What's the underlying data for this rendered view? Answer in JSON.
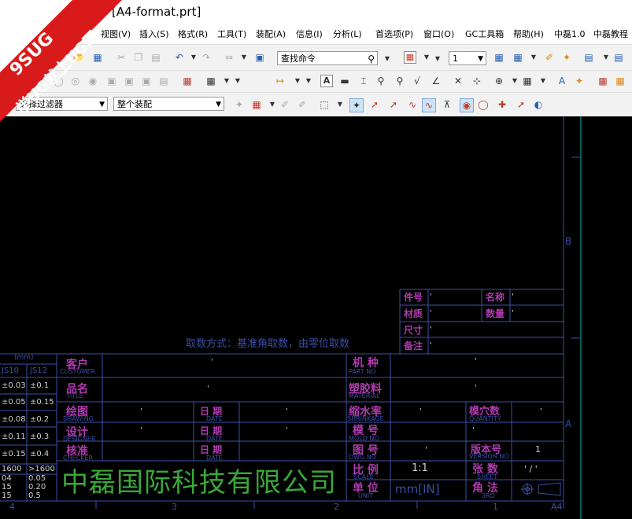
{
  "window": {
    "title": "[A4-format.prt]"
  },
  "watermark": {
    "line1": "9SUG",
    "line2": "学UG就上UG网"
  },
  "menu": [
    "视图(V)",
    "插入(S)",
    "格式(R)",
    "工具(T)",
    "装配(A)",
    "信息(I)",
    "分析(L)",
    "首选项(P)",
    "窗口(O)",
    "GC工具箱",
    "帮助(H)",
    "中磊1.0",
    "中磊教程"
  ],
  "toolbar": {
    "command_search": "查找命令",
    "layer_value": "1",
    "filter_placeholder": "选择过滤器",
    "assembly_scope": "整个装配"
  },
  "drawing": {
    "zone_labels": {
      "b": "B",
      "a": "A",
      "a4": "A4"
    },
    "bottom_ruler": [
      "4",
      "3",
      "2",
      "1"
    ],
    "note": "取数方式：基准角取数，由零位取数",
    "part_table": {
      "part_no": "件号",
      "name": "名称",
      "material": "材质",
      "qty": "数量",
      "size": "尺寸",
      "remark": "备注",
      "tick": "'"
    },
    "tolerance": {
      "header": "(mm)",
      "cols": [
        "JS10",
        "JS12"
      ],
      "rows": [
        [
          "±0.03",
          "±0.1"
        ],
        [
          "±0.05",
          "±0.15"
        ],
        [
          "±0.08",
          "±0.2"
        ],
        [
          "±0.11",
          "±0.3"
        ],
        [
          "±0.15",
          "±0.4"
        ]
      ],
      "big_header": [
        "1600",
        ">1600"
      ],
      "big_rows": [
        [
          "04",
          "0.05"
        ],
        [
          "15",
          "0.20"
        ],
        [
          "15",
          "0.5"
        ]
      ]
    },
    "title_block": {
      "customer_cn": "客户",
      "customer_en": "CUSTOMER",
      "title_cn": "品名",
      "title_en": "TITLE",
      "drawing_cn": "绘图",
      "drawing_en": "DRAWING",
      "designer_cn": "设计",
      "designer_en": "DESIGNER",
      "checker_cn": "核准",
      "checker_en": "CHECKER",
      "date_cn": "日 期",
      "date_en": "DATE",
      "partno_cn": "机 种",
      "partno_en": "PART NO",
      "material_cn": "塑胶料",
      "material_en": "MATERIAL",
      "shrink_cn": "缩水率",
      "shrink_en": "SHRINKAGE",
      "mold_cn": "模 号",
      "mold_en": "MOLD NO",
      "dwg_cn": "图 号",
      "dwg_en": "DWG NO",
      "scale_cn": "比 例",
      "scale_en": "SCALE",
      "unit_cn": "单 位",
      "unit_en": "UNIT",
      "quantity_cn": "模穴数",
      "quantity_en": "QUANTITY",
      "version_cn": "版本号",
      "version_en": "VERSION NO",
      "sheet_cn": "张 数",
      "sheet_en": "SHEET",
      "method_cn": "角 法",
      "method_en": "3RD",
      "scale_val": "1:1",
      "unit_val": "mm[IN]",
      "sheet_val": "' / '",
      "version_val": "1",
      "tick": "'",
      "company": "中磊国际科技有限公司"
    }
  }
}
